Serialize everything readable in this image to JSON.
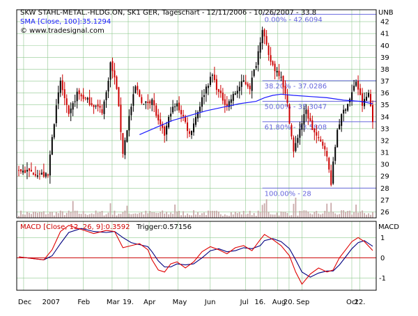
{
  "header": {
    "title": "SKW STAHL-METAL.-HLDG.ON, SK1 GER, Tageschart - 12/11/2006 - 10/26/2007 - 33.8",
    "sma_label": "SMA [Close, 100]:35.1294",
    "copyright": "© www.tradesignal.com",
    "right_corner": "UNB"
  },
  "macd_header": {
    "label": "MACD [Close, 12, 26, 9]:0.3592",
    "trigger": "Trigger:0.57156",
    "right_corner": "MACD"
  },
  "colors": {
    "bg": "#ffffff",
    "grid": "#8fc98f",
    "frame": "#000000",
    "candle_up": "#000000",
    "candle_down": "#cc0000",
    "sma": "#1a1aff",
    "macd": "#e00000",
    "trigger": "#000080",
    "volume": "#c9a9a9",
    "fib": "#6666dd",
    "zero_line": "#cc0000"
  },
  "chart_data": [
    {
      "type": "candlestick",
      "title": "SKW STAHL-METAL.-HLDG.ON, SK1 GER, Tageschart - 12/11/2006 - 10/26/2007 - 33.8",
      "x_tick_labels": [
        "Dec",
        "2007",
        "Feb",
        "Mar",
        "19.",
        "Apr",
        "May",
        "Jun",
        "Jul",
        "16.",
        "Aug",
        "20.",
        "Sep",
        "Oct",
        "22."
      ],
      "ylim": [
        25.5,
        43
      ],
      "y_ticks": [
        26,
        27,
        28,
        29,
        30,
        31,
        32,
        33,
        34,
        35,
        36,
        37,
        38,
        39,
        40,
        41,
        42
      ],
      "grid": true,
      "close_path": [
        [
          0,
          29.5
        ],
        [
          8,
          29.3
        ],
        [
          14,
          29.0
        ],
        [
          16,
          32.5
        ],
        [
          20,
          37.0
        ],
        [
          24,
          34.0
        ],
        [
          28,
          36.0
        ],
        [
          32,
          35.5
        ],
        [
          36,
          35.0
        ],
        [
          40,
          34.5
        ],
        [
          42,
          36.0
        ],
        [
          44,
          38.5
        ],
        [
          47,
          36.5
        ],
        [
          50,
          31.0
        ],
        [
          53,
          34.0
        ],
        [
          56,
          36.5
        ],
        [
          60,
          35.0
        ],
        [
          64,
          35.5
        ],
        [
          67,
          33.5
        ],
        [
          70,
          32.5
        ],
        [
          73,
          34.5
        ],
        [
          76,
          35.0
        ],
        [
          79,
          34.0
        ],
        [
          82,
          32.5
        ],
        [
          86,
          34.5
        ],
        [
          90,
          36.5
        ],
        [
          93,
          37.5
        ],
        [
          96,
          36.0
        ],
        [
          100,
          35.0
        ],
        [
          104,
          36.0
        ],
        [
          108,
          37.0
        ],
        [
          111,
          36.5
        ],
        [
          114,
          38.5
        ],
        [
          117,
          41.5
        ],
        [
          120,
          39.0
        ],
        [
          123,
          38.0
        ],
        [
          126,
          37.5
        ],
        [
          129,
          35.0
        ],
        [
          132,
          31.0
        ],
        [
          135,
          33.0
        ],
        [
          138,
          34.5
        ],
        [
          141,
          33.0
        ],
        [
          144,
          32.0
        ],
        [
          147,
          31.5
        ],
        [
          150,
          28.5
        ],
        [
          153,
          33.0
        ],
        [
          156,
          34.5
        ],
        [
          159,
          35.5
        ],
        [
          162,
          37.0
        ],
        [
          165,
          35.0
        ],
        [
          168,
          36.0
        ],
        [
          170,
          33.8
        ]
      ],
      "sma_path": [
        [
          58,
          32.5
        ],
        [
          66,
          33.1
        ],
        [
          74,
          33.7
        ],
        [
          82,
          34.1
        ],
        [
          90,
          34.5
        ],
        [
          98,
          34.8
        ],
        [
          106,
          35.1
        ],
        [
          114,
          35.3
        ],
        [
          118,
          35.6
        ],
        [
          122,
          35.8
        ],
        [
          126,
          35.9
        ],
        [
          132,
          35.8
        ],
        [
          140,
          35.7
        ],
        [
          148,
          35.6
        ],
        [
          156,
          35.4
        ],
        [
          164,
          35.3
        ],
        [
          170,
          35.1
        ]
      ],
      "fibonacci": {
        "x_start": 117,
        "levels": [
          {
            "label": "0.00% - 42.6094",
            "value": 42.6094
          },
          {
            "label": "38.20% - 37.0286",
            "value": 37.0286
          },
          {
            "label": "50.00% - 35.3047",
            "value": 35.3047
          },
          {
            "label": "61.80% - 33.5808",
            "value": 33.5808
          },
          {
            "label": "100.00% - 28",
            "value": 28
          }
        ]
      },
      "volume": {
        "spike_indices": [
          26,
          44,
          52,
          75,
          117,
          118,
          119,
          132,
          133,
          148,
          150,
          162
        ]
      }
    },
    {
      "type": "line",
      "title": "MACD [Close, 12, 26, 9]:0.3592",
      "ylim": [
        -1.6,
        1.8
      ],
      "y_ticks": [
        1,
        0,
        -1
      ],
      "series": [
        {
          "name": "MACD [Close, 12, 26, 9]",
          "points": [
            [
              0,
              0.05
            ],
            [
              8,
              -0.05
            ],
            [
              12,
              -0.1
            ],
            [
              16,
              0.4
            ],
            [
              20,
              1.3
            ],
            [
              24,
              1.6
            ],
            [
              30,
              1.4
            ],
            [
              36,
              1.2
            ],
            [
              42,
              1.35
            ],
            [
              46,
              1.3
            ],
            [
              50,
              0.5
            ],
            [
              54,
              0.6
            ],
            [
              58,
              0.7
            ],
            [
              62,
              0.4
            ],
            [
              64,
              -0.1
            ],
            [
              67,
              -0.6
            ],
            [
              70,
              -0.7
            ],
            [
              73,
              -0.3
            ],
            [
              76,
              -0.2
            ],
            [
              80,
              -0.5
            ],
            [
              84,
              -0.2
            ],
            [
              88,
              0.3
            ],
            [
              92,
              0.55
            ],
            [
              96,
              0.4
            ],
            [
              100,
              0.2
            ],
            [
              104,
              0.5
            ],
            [
              108,
              0.6
            ],
            [
              112,
              0.35
            ],
            [
              116,
              0.9
            ],
            [
              118,
              1.15
            ],
            [
              122,
              0.9
            ],
            [
              126,
              0.6
            ],
            [
              130,
              0.1
            ],
            [
              133,
              -0.7
            ],
            [
              136,
              -1.3
            ],
            [
              140,
              -0.8
            ],
            [
              144,
              -0.5
            ],
            [
              148,
              -0.7
            ],
            [
              151,
              -0.6
            ],
            [
              154,
              0.0
            ],
            [
              157,
              0.4
            ],
            [
              160,
              0.8
            ],
            [
              163,
              1.0
            ],
            [
              166,
              0.8
            ],
            [
              170,
              0.36
            ]
          ]
        },
        {
          "name": "Trigger",
          "points": [
            [
              0,
              0.05
            ],
            [
              8,
              -0.05
            ],
            [
              12,
              -0.1
            ],
            [
              16,
              0.1
            ],
            [
              20,
              0.7
            ],
            [
              24,
              1.25
            ],
            [
              30,
              1.45
            ],
            [
              36,
              1.3
            ],
            [
              42,
              1.25
            ],
            [
              46,
              1.3
            ],
            [
              50,
              1.0
            ],
            [
              54,
              0.75
            ],
            [
              58,
              0.65
            ],
            [
              62,
              0.55
            ],
            [
              64,
              0.3
            ],
            [
              67,
              -0.15
            ],
            [
              70,
              -0.45
            ],
            [
              73,
              -0.45
            ],
            [
              76,
              -0.3
            ],
            [
              80,
              -0.35
            ],
            [
              84,
              -0.3
            ],
            [
              88,
              0.0
            ],
            [
              92,
              0.35
            ],
            [
              96,
              0.45
            ],
            [
              100,
              0.3
            ],
            [
              104,
              0.35
            ],
            [
              108,
              0.5
            ],
            [
              112,
              0.45
            ],
            [
              116,
              0.6
            ],
            [
              118,
              0.85
            ],
            [
              122,
              0.95
            ],
            [
              126,
              0.8
            ],
            [
              130,
              0.45
            ],
            [
              133,
              -0.1
            ],
            [
              136,
              -0.7
            ],
            [
              140,
              -0.95
            ],
            [
              144,
              -0.75
            ],
            [
              148,
              -0.65
            ],
            [
              151,
              -0.65
            ],
            [
              154,
              -0.35
            ],
            [
              157,
              0.05
            ],
            [
              160,
              0.45
            ],
            [
              163,
              0.75
            ],
            [
              166,
              0.85
            ],
            [
              170,
              0.57
            ]
          ]
        }
      ]
    }
  ]
}
